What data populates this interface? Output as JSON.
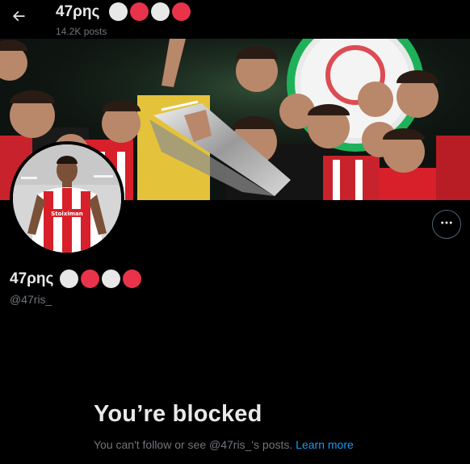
{
  "header": {
    "name": "47ρης",
    "post_count": "14.2K posts",
    "back_icon": "arrow-left-icon"
  },
  "status_dots": [
    {
      "color": "#e8e8e8"
    },
    {
      "color": "#e8334a"
    },
    {
      "color": "#e8e8e8"
    },
    {
      "color": "#e8334a"
    }
  ],
  "profile": {
    "display_name": "47ρης",
    "handle": "@47ris_",
    "more_icon": "more-horizontal-icon"
  },
  "blocked": {
    "title": "You’re blocked",
    "description": "You can't follow or see @47ris_'s posts.",
    "learn_more": "Learn more"
  },
  "colors": {
    "background": "#000000",
    "text_primary": "#e7e9ea",
    "text_secondary": "#71767b",
    "accent": "#1d9bf0",
    "olympiacos_red": "#d7202a"
  }
}
